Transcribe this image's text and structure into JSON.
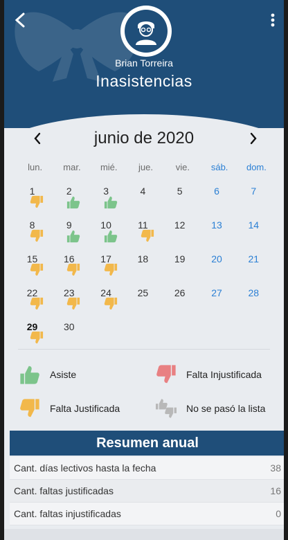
{
  "header": {
    "student_name": "Brian Torreira",
    "title": "Inasistencias"
  },
  "calendar": {
    "month_label": "junio de 2020",
    "weekdays": [
      "lun.",
      "mar.",
      "mié.",
      "jue.",
      "vie.",
      "sáb.",
      "dom."
    ],
    "days": [
      {
        "n": "1",
        "status": "falta_justificada"
      },
      {
        "n": "2",
        "status": "asiste"
      },
      {
        "n": "3",
        "status": "asiste"
      },
      {
        "n": "4",
        "status": ""
      },
      {
        "n": "5",
        "status": ""
      },
      {
        "n": "6",
        "status": "",
        "weekend": true
      },
      {
        "n": "7",
        "status": "",
        "weekend": true
      },
      {
        "n": "8",
        "status": "falta_justificada"
      },
      {
        "n": "9",
        "status": "asiste"
      },
      {
        "n": "10",
        "status": "asiste"
      },
      {
        "n": "11",
        "status": "falta_justificada"
      },
      {
        "n": "12",
        "status": ""
      },
      {
        "n": "13",
        "status": "",
        "weekend": true
      },
      {
        "n": "14",
        "status": "",
        "weekend": true
      },
      {
        "n": "15",
        "status": "falta_justificada"
      },
      {
        "n": "16",
        "status": "falta_justificada"
      },
      {
        "n": "17",
        "status": "falta_justificada"
      },
      {
        "n": "18",
        "status": ""
      },
      {
        "n": "19",
        "status": ""
      },
      {
        "n": "20",
        "status": "",
        "weekend": true
      },
      {
        "n": "21",
        "status": "",
        "weekend": true
      },
      {
        "n": "22",
        "status": "falta_justificada"
      },
      {
        "n": "23",
        "status": "falta_justificada"
      },
      {
        "n": "24",
        "status": "falta_justificada"
      },
      {
        "n": "25",
        "status": ""
      },
      {
        "n": "26",
        "status": ""
      },
      {
        "n": "27",
        "status": "",
        "weekend": true
      },
      {
        "n": "28",
        "status": "",
        "weekend": true
      },
      {
        "n": "29",
        "status": "falta_justificada",
        "today": true
      },
      {
        "n": "30",
        "status": ""
      }
    ]
  },
  "legend": {
    "asiste": "Asiste",
    "falta_injustificada": "Falta Injustificada",
    "falta_justificada": "Falta Justificada",
    "no_lista": "No se pasó la lista"
  },
  "colors": {
    "header": "#1f4e79",
    "asiste": "#7cc48b",
    "falta_justificada": "#f2b84b",
    "falta_injustificada": "#e88082",
    "no_lista": "#b8b8b8",
    "weekend": "#2a7fd4"
  },
  "summary": {
    "title": "Resumen anual",
    "rows": [
      {
        "label": "Cant. días lectivos hasta la fecha",
        "value": "38"
      },
      {
        "label": "Cant. faltas justificadas",
        "value": "16"
      },
      {
        "label": "Cant. faltas injustificadas",
        "value": "0"
      }
    ]
  }
}
